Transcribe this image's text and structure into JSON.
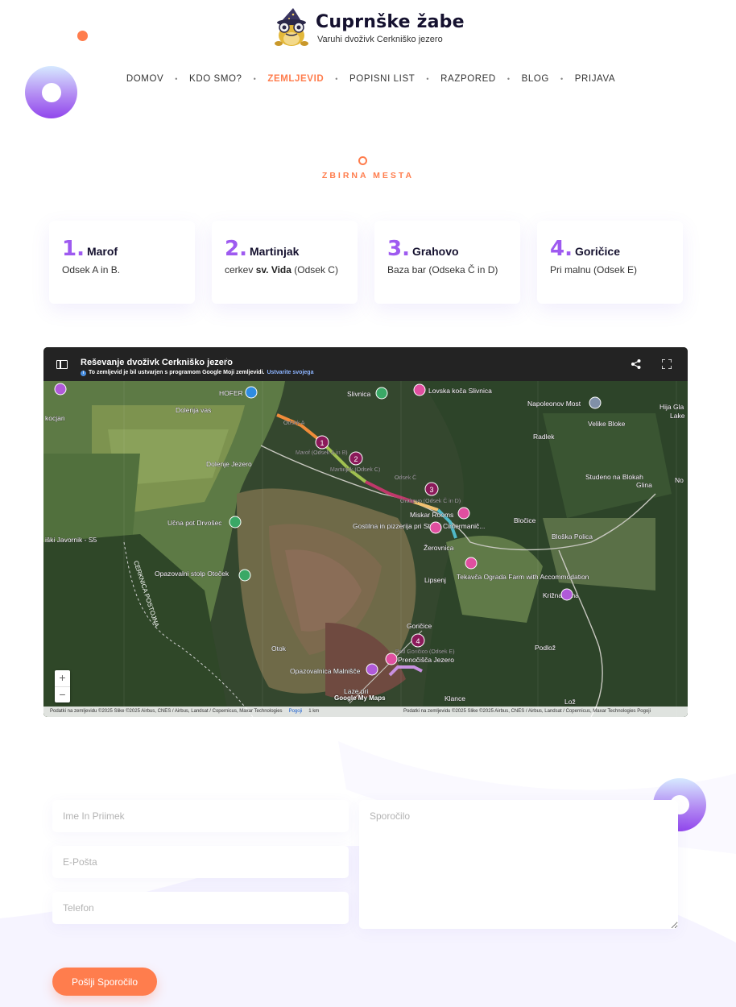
{
  "site": {
    "title": "Cuprnške žabe",
    "subtitle": "Varuhi dvoživk Cerkniško jezero"
  },
  "nav": {
    "items": [
      {
        "label": "DOMOV",
        "active": false
      },
      {
        "label": "KDO SMO?",
        "active": false
      },
      {
        "label": "ZEMLJEVID",
        "active": true
      },
      {
        "label": "POPISNI LIST",
        "active": false
      },
      {
        "label": "RAZPORED",
        "active": false
      },
      {
        "label": "BLOG",
        "active": false
      },
      {
        "label": "PRIJAVA",
        "active": false
      }
    ],
    "separator": "•"
  },
  "section": {
    "title": "ZBIRNA MESTA"
  },
  "cards": [
    {
      "num": "1.",
      "name": "Marof",
      "desc_pre": "Odsek A in B.",
      "desc_bold": "",
      "desc_post": ""
    },
    {
      "num": "2.",
      "name": "Martinjak",
      "desc_pre": "cerkev ",
      "desc_bold": "sv. Vida",
      "desc_post": " (Odsek C)"
    },
    {
      "num": "3.",
      "name": "Grahovo",
      "desc_pre": "Baza bar (Odseka Č in D)",
      "desc_bold": "",
      "desc_post": ""
    },
    {
      "num": "4.",
      "name": "Goričice",
      "desc_pre": "Pri malnu (Odsek E)",
      "desc_bold": "",
      "desc_post": ""
    }
  ],
  "map": {
    "title": "Reševanje dvoživk Cerkniško jezero",
    "note": "To zemljevid je bil ustvarjen s programom Google Moji zemljevidi.",
    "note_link": "Ustvarite svojega",
    "footer_left": "Podatki na zemljevidu ©2025 Slike ©2025 Airbus, CNES / Airbus, Landsat / Copernicus, Maxar Technologies",
    "footer_terms": "Pogoji",
    "footer_scale": "1 km",
    "footer_right": "Podatki na zemljevidu ©2025 Slike ©2025 Airbus, CNES / Airbus, Landsat / Copernicus, Maxar Technologies",
    "footer_terms2": "Pogoji",
    "badge": "Google My Maps",
    "zoom_in": "+",
    "zoom_out": "−",
    "places": [
      "kocjan",
      "Dolenja vas",
      "HOFER",
      "Slivnica",
      "Lovska koča Slivnica",
      "Napoleonov Most",
      "Hija Gla",
      "Lake",
      "Velike Bloke",
      "Radlek",
      "Dolenje Jezero",
      "Studeno na Blokah",
      "Glina",
      "No",
      "Učna pot Drvošec",
      "Miskar Rooms",
      "Bločice",
      "Gostilna in pizzerija pri Stani, Cimermanič...",
      "Bloška Polica",
      "Žerovnica",
      "iški Javornik - S5",
      "Tekavča Ograda Farm with Accommodation",
      "Lipsenj",
      "Opazovalni stolp Otoček",
      "Križna jama",
      "CERKNICA POSTOJNA",
      "Goričice",
      "Podlož",
      "Otok",
      "Prenočišča Jezero",
      "Opazovalnica Malnišče",
      "Laze pri",
      "Klance",
      "Lož",
      "CERKNICA POSTOJNA",
      "Otava"
    ],
    "route_labels": [
      "Odsek A",
      "Marof (Odsek A in B)",
      "Martinjak (Odsek C)",
      "Odsek Č",
      "Grahovo (Odsek Č in D)",
      "Pod Goričico (Odsek E)"
    ],
    "markers": [
      "1",
      "2",
      "3",
      "4"
    ],
    "road_numbers": [
      "914",
      "212",
      "213",
      "213",
      "213"
    ]
  },
  "form": {
    "name_placeholder": "Ime In Priimek",
    "email_placeholder": "E-Pošta",
    "phone_placeholder": "Telefon",
    "message_placeholder": "Sporočilo",
    "submit_label": "Pošlji Sporočilo"
  },
  "colors": {
    "accent": "#ff7d4d",
    "purple": "#9e5af0",
    "dark": "#15112f"
  }
}
